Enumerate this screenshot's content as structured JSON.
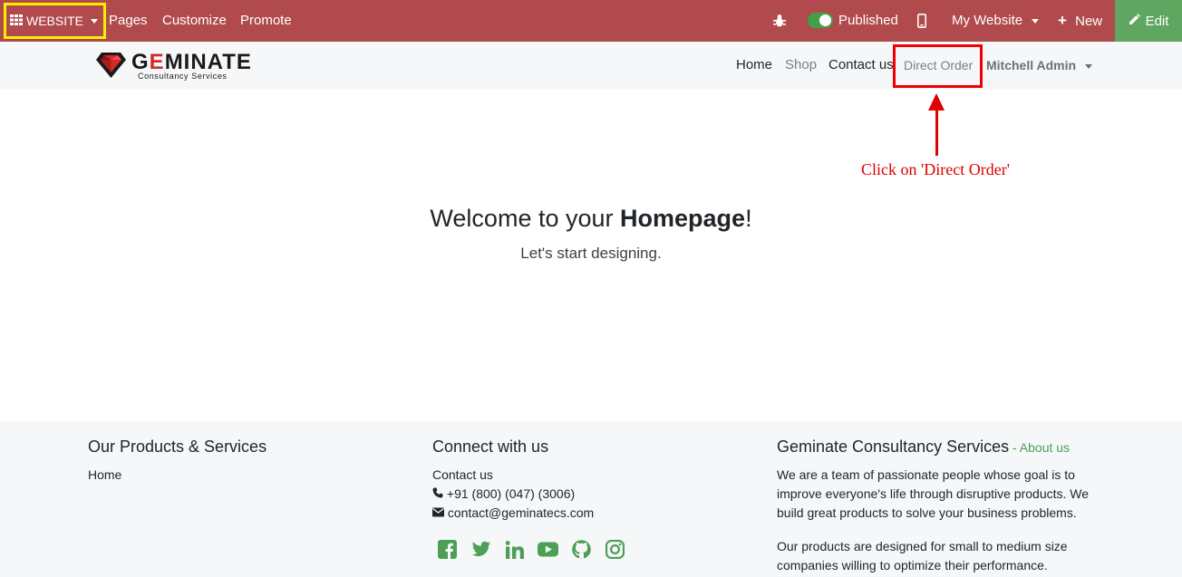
{
  "topbar": {
    "website_label": "WEBSITE",
    "menu": [
      "Pages",
      "Customize",
      "Promote"
    ],
    "published_label": "Published",
    "my_website_label": "My Website",
    "new_label": "New",
    "edit_label": "Edit",
    "bg_color": "#b04a4c",
    "edit_color": "#5fa760"
  },
  "header": {
    "logo_text_pre": "G",
    "logo_text_e": "E",
    "logo_text_post": "MINATE",
    "logo_subtitle": "Consultancy Services",
    "nav": {
      "home": "Home",
      "shop": "Shop",
      "contact": "Contact us",
      "direct_order": "Direct Order",
      "user": "Mitchell Admin"
    }
  },
  "annotation": {
    "text": "Click on 'Direct Order'",
    "color": "#e00000"
  },
  "hero": {
    "title_pre": "Welcome to your ",
    "title_bold": "Homepage",
    "title_post": "!",
    "subtitle": "Let's start designing."
  },
  "footer": {
    "col1": {
      "heading": "Our Products & Services",
      "links": [
        "Home"
      ]
    },
    "col2": {
      "heading": "Connect with us",
      "contact_link": "Contact us",
      "phone": "+91 (800) (047) (3006)",
      "email": "contact@geminatecs.com",
      "social_icons": [
        "facebook-icon",
        "twitter-icon",
        "linkedin-icon",
        "youtube-icon",
        "github-icon",
        "instagram-icon"
      ]
    },
    "col3": {
      "heading": "Geminate Consultancy Services",
      "heading_sep": " - ",
      "about_link": "About us",
      "para1": "We are a team of passionate people whose goal is to improve everyone's life through disruptive products. We build great products to solve your business problems.",
      "para2": "Our products are designed for small to medium size companies willing to optimize their performance."
    },
    "link_color": "#4c9f55"
  }
}
